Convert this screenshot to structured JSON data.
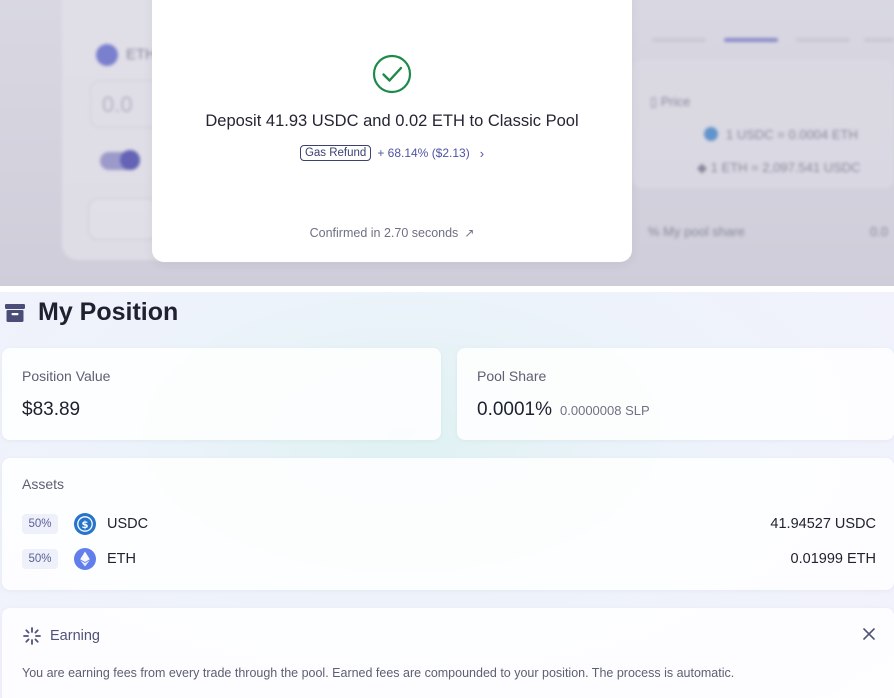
{
  "background": {
    "eth_label": "ETH",
    "amount_placeholder": "0.0",
    "price_label": "Price",
    "rate_usdc_eth": "1 USDC = 0.0004 ETH",
    "rate_eth_usdc": "1 ETH = 2,097.541 USDC",
    "pool_share_label": "My pool share",
    "pool_share_value": "0.0"
  },
  "modal": {
    "title": "Deposit 41.93 USDC and 0.02 ETH to Classic Pool",
    "gas_badge": "Gas Refund",
    "gas_refund_text": "+ 68.14% ($2.13)",
    "confirmed_text": "Confirmed in 2.70 seconds"
  },
  "position": {
    "title": "My Position",
    "value_label": "Position Value",
    "value": "$83.89",
    "share_label": "Pool Share",
    "share_percent": "0.0001%",
    "share_lp": "0.0000008 SLP",
    "assets_label": "Assets",
    "assets": [
      {
        "pct": "50%",
        "name": "USDC",
        "amount": "41.94527 USDC",
        "icon": "usdc-icon"
      },
      {
        "pct": "50%",
        "name": "ETH",
        "amount": "0.01999 ETH",
        "icon": "eth-icon"
      }
    ]
  },
  "earning": {
    "title": "Earning",
    "text": "You are earning fees from every trade through the pool. Earned fees are compounded to your position. The process is automatic."
  },
  "colors": {
    "accent": "#4f55a3",
    "success": "#1e8a4a",
    "usdc": "#2775ca",
    "eth": "#627eea"
  }
}
